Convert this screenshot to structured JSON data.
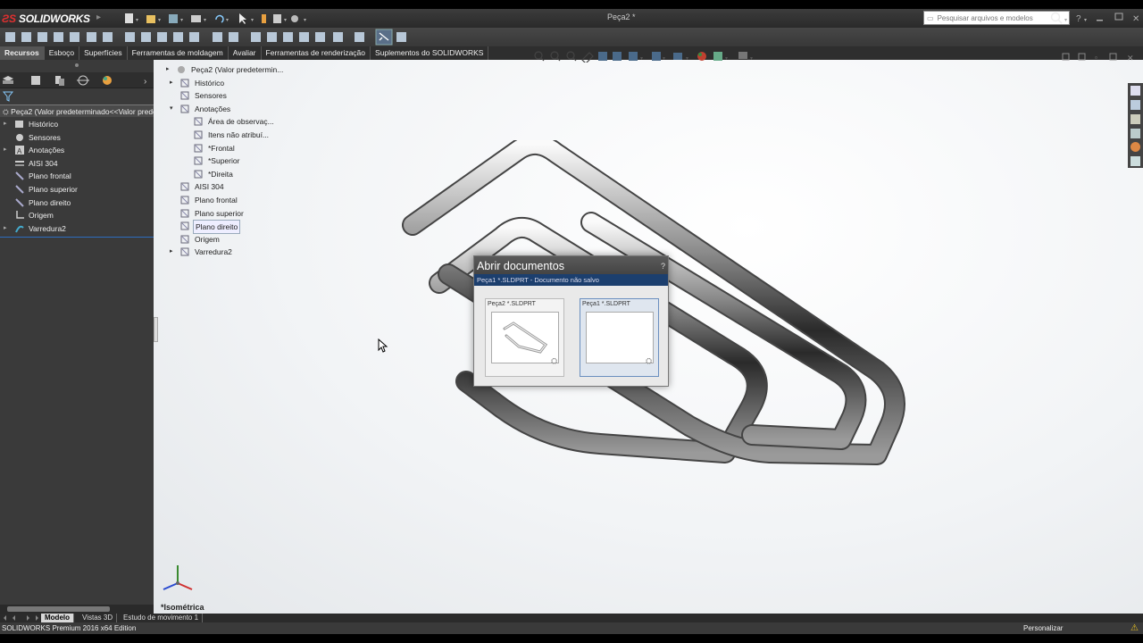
{
  "app": {
    "name": "SOLIDWORKS",
    "window_title": "Peça2 *"
  },
  "search": {
    "placeholder": "Pesquisar arquivos e modelos"
  },
  "tabs": [
    "Recursos",
    "Esboço",
    "Superfícies",
    "Ferramentas de moldagem",
    "Avaliar",
    "Ferramentas de renderização",
    "Suplementos do SOLIDWORKS"
  ],
  "left_tree": {
    "root": "Peça2  (Valor predeterminado<<Valor prede",
    "items": [
      {
        "label": "Histórico",
        "arrow": "▸",
        "icon": "history-icon"
      },
      {
        "label": "Sensores",
        "arrow": "",
        "icon": "sensor-icon"
      },
      {
        "label": "Anotações",
        "arrow": "▸",
        "icon": "annotation-icon"
      },
      {
        "label": "AISI 304",
        "arrow": "",
        "icon": "material-icon"
      },
      {
        "label": "Plano frontal",
        "arrow": "",
        "icon": "plane-icon"
      },
      {
        "label": "Plano superior",
        "arrow": "",
        "icon": "plane-icon"
      },
      {
        "label": "Plano direito",
        "arrow": "",
        "icon": "plane-icon"
      },
      {
        "label": "Origem",
        "arrow": "",
        "icon": "origin-icon"
      },
      {
        "label": "Varredura2",
        "arrow": "▸",
        "icon": "sweep-icon"
      }
    ]
  },
  "flyout_tree": {
    "root": "Peça2  (Valor predetermin...",
    "items": [
      {
        "label": "Histórico",
        "arrow": "▸",
        "indent": 0
      },
      {
        "label": "Sensores",
        "arrow": "",
        "indent": 0
      },
      {
        "label": "Anotações",
        "arrow": "▾",
        "indent": 0
      },
      {
        "label": "Área de observaç...",
        "arrow": "",
        "indent": 1
      },
      {
        "label": "Itens não atribuí...",
        "arrow": "",
        "indent": 1
      },
      {
        "label": "*Frontal",
        "arrow": "",
        "indent": 1
      },
      {
        "label": "*Superior",
        "arrow": "",
        "indent": 1
      },
      {
        "label": "*Direita",
        "arrow": "",
        "indent": 1
      },
      {
        "label": "AISI 304",
        "arrow": "",
        "indent": 0
      },
      {
        "label": "Plano frontal",
        "arrow": "",
        "indent": 0
      },
      {
        "label": "Plano superior",
        "arrow": "",
        "indent": 0
      },
      {
        "label": "Plano direito",
        "arrow": "",
        "indent": 0,
        "selected": true
      },
      {
        "label": "Origem",
        "arrow": "",
        "indent": 0
      },
      {
        "label": "Varredura2",
        "arrow": "▸",
        "indent": 0
      }
    ]
  },
  "dialog": {
    "title": "Abrir documentos",
    "help": "?",
    "subtitle": "Peça1 *.SLDPRT - Documento não salvo",
    "docs": [
      {
        "label": "Peça2 *.SLDPRT",
        "has_preview": true
      },
      {
        "label": "Peça1 *.SLDPRT",
        "has_preview": false,
        "selected": true
      }
    ]
  },
  "view_label": "*Isométrica",
  "bottom_tabs": [
    "Modelo",
    "Vistas 3D",
    "Estudo de movimento 1"
  ],
  "status": {
    "left": "SOLIDWORKS Premium 2016 x64 Edition",
    "right": "Personalizar"
  },
  "colors": {
    "accent": "#1c3f6e",
    "selection": "#2d6ec0",
    "logo_red": "#e03030"
  }
}
